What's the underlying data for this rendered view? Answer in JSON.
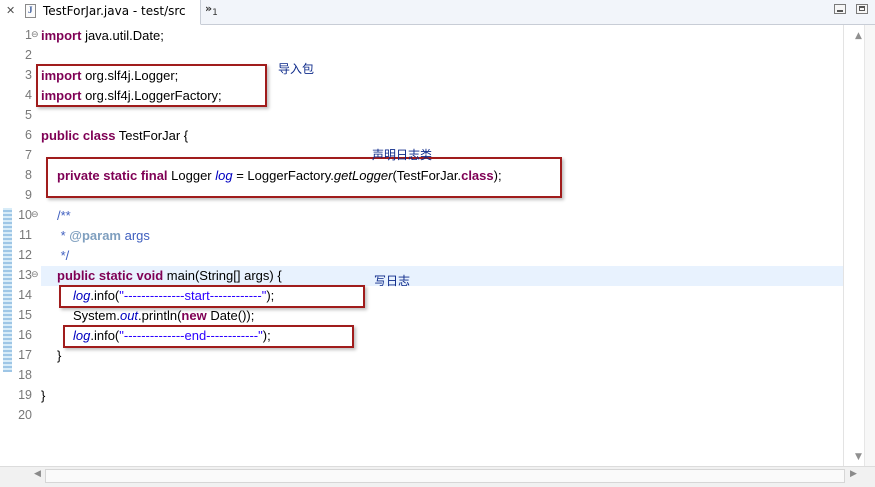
{
  "tab": {
    "close_glyph": "✕",
    "title": "TestForJar.java - test/src",
    "overflow_chevron": "»",
    "overflow_count": "1"
  },
  "editor": {
    "lines": [
      {
        "num": "1",
        "fold": "⊖"
      },
      {
        "num": "2"
      },
      {
        "num": "3"
      },
      {
        "num": "4"
      },
      {
        "num": "5"
      },
      {
        "num": "6"
      },
      {
        "num": "7"
      },
      {
        "num": "8"
      },
      {
        "num": "9"
      },
      {
        "num": "10",
        "fold": "⊖"
      },
      {
        "num": "11"
      },
      {
        "num": "12"
      },
      {
        "num": "13",
        "fold": "⊖"
      },
      {
        "num": "14"
      },
      {
        "num": "15"
      },
      {
        "num": "16"
      },
      {
        "num": "17"
      },
      {
        "num": "18"
      },
      {
        "num": "19"
      },
      {
        "num": "20"
      }
    ],
    "code": {
      "l1_kw": "import",
      "l1_rest": " java.util.Date;",
      "l3_kw": "import",
      "l3_rest": " org.slf4j.Logger;",
      "l4_kw": "import",
      "l4_rest": " org.slf4j.LoggerFactory;",
      "l6_kw": "public class",
      "l6_rest": " TestForJar {",
      "l8_kw": "private static final",
      "l8_a": " Logger ",
      "l8_field": "log",
      "l8_b": " = LoggerFactory.",
      "l8_method": "getLogger",
      "l8_c": "(TestForJar.",
      "l8_kw2": "class",
      "l8_d": ");",
      "l10": "/**",
      "l11_a": " * ",
      "l11_tag": "@param",
      "l11_b": " args",
      "l12": " */",
      "l13_kw": "public static void",
      "l13_rest": " main(String[] args) {",
      "l14_field": "log",
      "l14_a": ".info(",
      "l14_str": "\"--------------start------------\"",
      "l14_b": ");",
      "l15_a": "System.",
      "l15_field": "out",
      "l15_b": ".println(",
      "l15_kw": "new",
      "l15_c": " Date());",
      "l16_field": "log",
      "l16_a": ".info(",
      "l16_str": "\"--------------end------------\"",
      "l16_b": ");",
      "l17": "}",
      "l19": "}"
    }
  },
  "annotations": {
    "import_note": "导入包",
    "declare_note": "声明日志类",
    "write_note": "写日志"
  },
  "colors": {
    "keyword": "#7f0055",
    "string": "#2a00ff",
    "field": "#0000c0",
    "annotation_box": "#a01c1c",
    "annotation_text": "#0d2a8a"
  }
}
